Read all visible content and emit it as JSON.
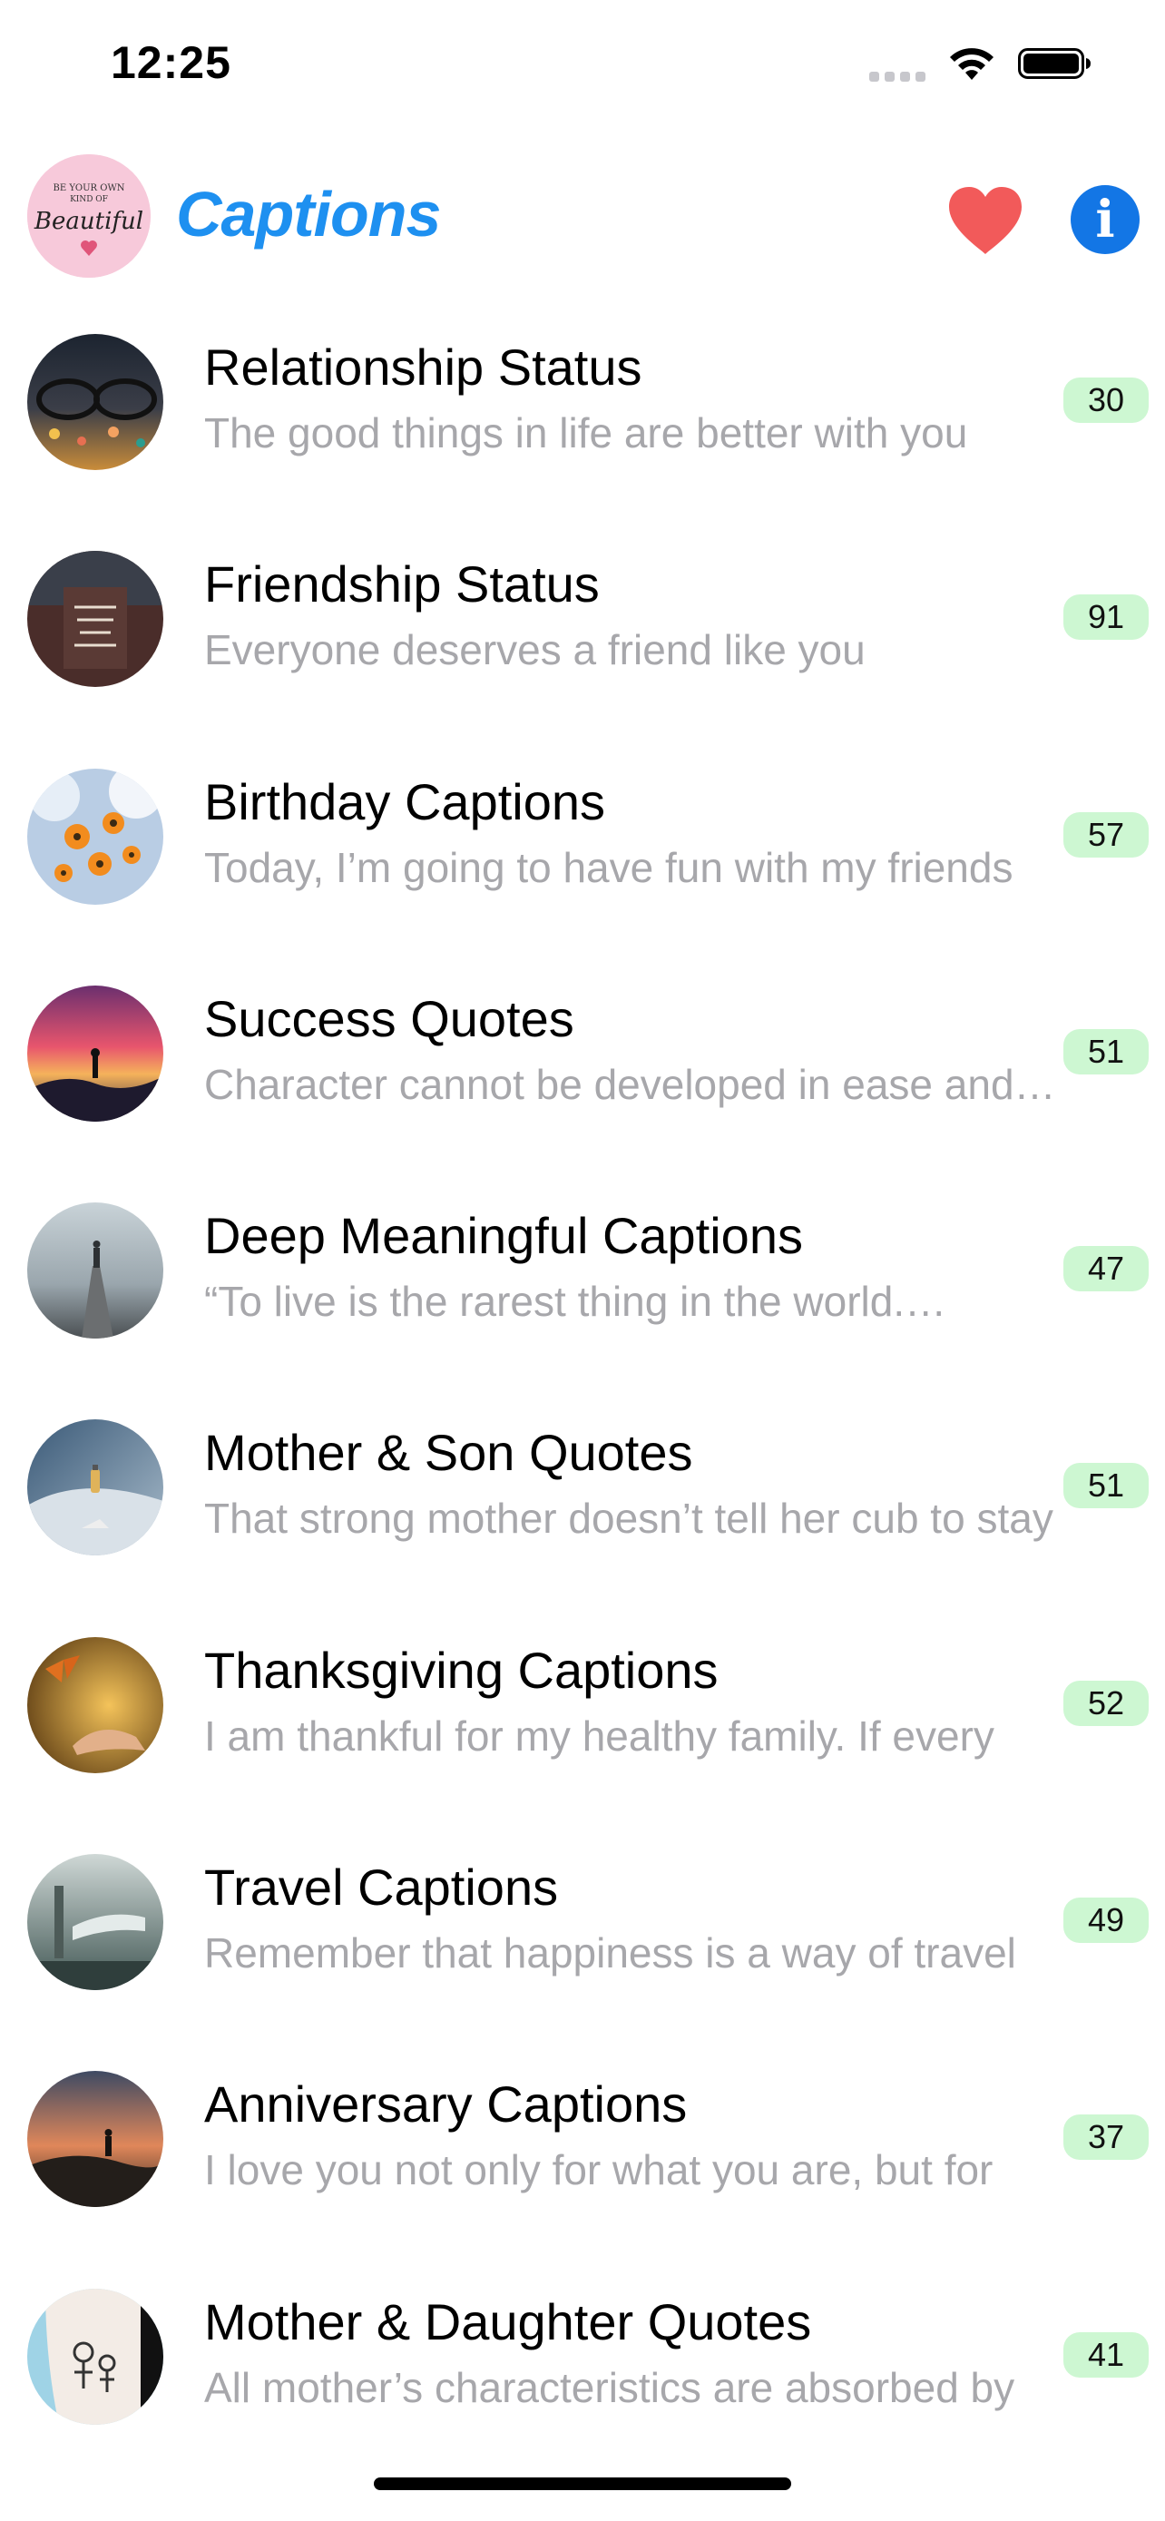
{
  "status_bar": {
    "time": "12:25"
  },
  "header": {
    "title": "Captions",
    "logo_text": "Be your own kind of Beautiful"
  },
  "categories": [
    {
      "title": "Relationship Status",
      "subtitle": "The good things in life are better with you",
      "count": "30"
    },
    {
      "title": "Friendship Status",
      "subtitle": "Everyone deserves a friend like you",
      "count": "91"
    },
    {
      "title": "Birthday Captions",
      "subtitle": "Today, I’m going to have fun with my friends",
      "count": "57"
    },
    {
      "title": "Success Quotes",
      "subtitle": "Character cannot be developed in ease and quiet",
      "count": "51"
    },
    {
      "title": "Deep Meaningful Captions",
      "subtitle": "“To live is the rarest thing in the world.…",
      "count": "47"
    },
    {
      "title": "Mother & Son Quotes",
      "subtitle": "That strong mother doesn’t tell her cub to stay",
      "count": "51"
    },
    {
      "title": "Thanksgiving Captions",
      "subtitle": "I am thankful for my healthy family. If every",
      "count": "52"
    },
    {
      "title": "Travel Captions",
      "subtitle": "Remember that happiness is a way of travel",
      "count": "49"
    },
    {
      "title": "Anniversary Captions",
      "subtitle": "I love you not only for what you are, but for",
      "count": "37"
    },
    {
      "title": "Mother & Daughter Quotes",
      "subtitle": "All mother’s characteristics are absorbed by",
      "count": "41"
    }
  ],
  "colors": {
    "accent": "#1e90f0",
    "heart": "#f25a5a",
    "badge": "#cdf7d2",
    "subtitle": "#a7a7ab"
  },
  "icons": {
    "favorite": "heart-icon",
    "info": "info-icon",
    "wifi": "wifi-icon",
    "battery": "battery-icon"
  }
}
